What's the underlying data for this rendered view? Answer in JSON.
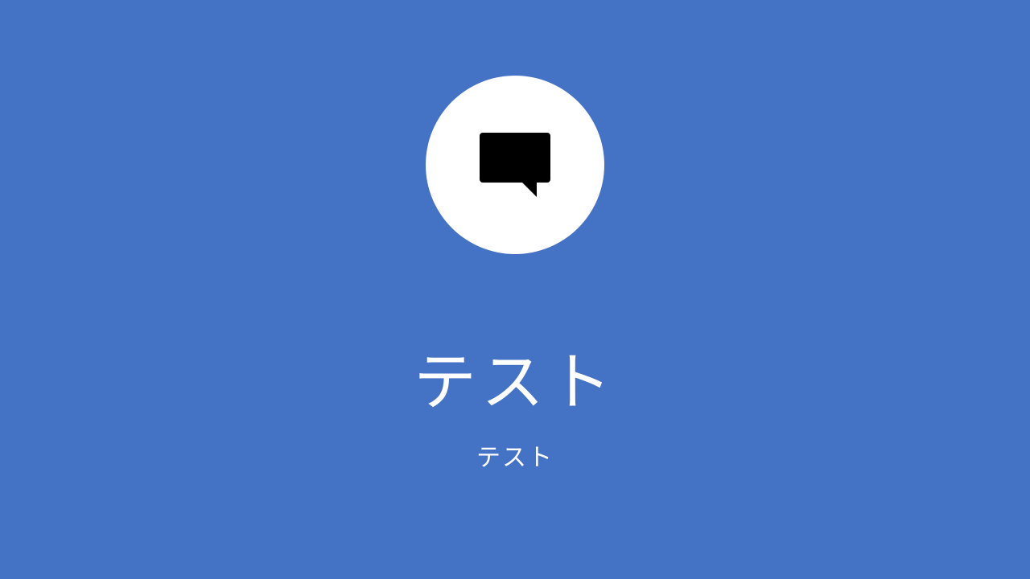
{
  "slide": {
    "icon": "speech-bubble-icon",
    "title": "テスト",
    "subtitle": "テスト"
  },
  "colors": {
    "background": "#4472C4",
    "circle": "#FFFFFF",
    "icon": "#000000",
    "text": "#FFFFFF"
  }
}
